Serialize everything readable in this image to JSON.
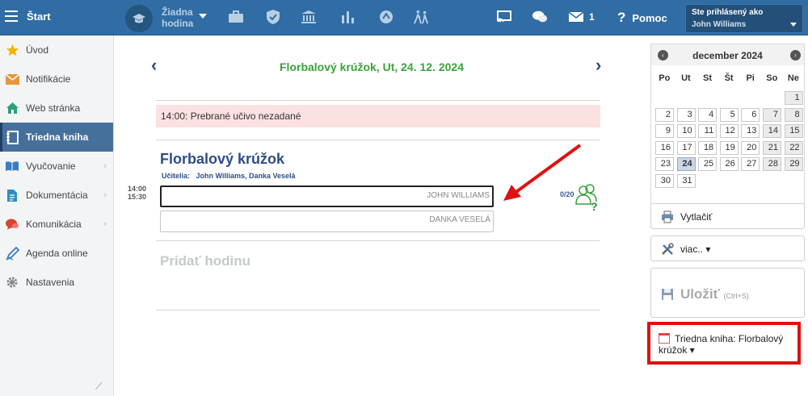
{
  "topbar": {
    "start_label": "Štart",
    "no_lesson_line1": "Žiadna",
    "no_lesson_line2": "hodina",
    "messages_count": "1",
    "help_label": "Pomoc",
    "help_icon": "?",
    "user_prefix": "Ste prihlásený ako",
    "user_name": "John Williams",
    "icons": [
      "graduation-cap-icon",
      "briefcase-icon",
      "shield-check-icon",
      "bank-icon",
      "bar-chart-icon",
      "badge-icon",
      "walking-people-icon",
      "cast-icon",
      "chat-bubbles-icon",
      "envelope-icon"
    ]
  },
  "sidebar": {
    "items": [
      {
        "label": "Úvod",
        "icon": "star-icon",
        "color": "#f1b400"
      },
      {
        "label": "Notifikácie",
        "icon": "envelope-icon",
        "color": "#e8963a"
      },
      {
        "label": "Web stránka",
        "icon": "home-icon",
        "color": "#2e9e7a"
      },
      {
        "label": "Triedna kniha",
        "icon": "notebook-icon",
        "color": "#ffffff",
        "active": true
      },
      {
        "label": "Vyučovanie",
        "icon": "open-book-icon",
        "color": "#3a7cc0",
        "has_submenu": true
      },
      {
        "label": "Dokumentácia",
        "icon": "document-icon",
        "color": "#2e8fc0",
        "has_submenu": true
      },
      {
        "label": "Komunikácia",
        "icon": "chat-icon",
        "color": "#d5452f",
        "has_submenu": true
      },
      {
        "label": "Agenda online",
        "icon": "pen-icon",
        "color": "#3a7cc0"
      },
      {
        "label": "Nastavenia",
        "icon": "gear-icon",
        "color": "#888888"
      }
    ]
  },
  "main": {
    "prev_arrow": "‹",
    "next_arrow": "›",
    "title": "Florbalový krúžok, Ut, 24. 12. 2024",
    "alert": "14:00: Prebrané učivo nezadané",
    "lesson": {
      "name": "Florbalový krúžok",
      "teachers_label": "Učitelia:",
      "teachers": "John Williams, Danka Veselá",
      "time_start": "14:00",
      "time_end": "15:30",
      "teacher_boxes": [
        "JOHN WILLIAMS",
        "DANKA VESELÁ"
      ],
      "attendance": "0/20"
    },
    "add_lesson": "Pridať hodinu"
  },
  "calendar": {
    "month": "december 2024",
    "prev": "‹",
    "next": "›",
    "dows": [
      "Po",
      "Ut",
      "St",
      "Št",
      "Pi",
      "So",
      "Ne"
    ],
    "weeks": [
      [
        "",
        "",
        "",
        "",
        "",
        "",
        "1"
      ],
      [
        "2",
        "3",
        "4",
        "5",
        "6",
        "7",
        "8"
      ],
      [
        "9",
        "10",
        "11",
        "12",
        "13",
        "14",
        "15"
      ],
      [
        "16",
        "17",
        "18",
        "19",
        "20",
        "21",
        "22"
      ],
      [
        "23",
        "24",
        "25",
        "26",
        "27",
        "28",
        "29"
      ],
      [
        "30",
        "31",
        "",
        "",
        "",
        "",
        ""
      ]
    ],
    "today": "24"
  },
  "actions": {
    "print_label": "Vytlačiť",
    "more_label": "viac.. ▾",
    "save_label": "Uložiť",
    "save_hint": "(Ctrl+S)",
    "classbook_label": "Triedna kniha: Florbalový krúžok ▾"
  },
  "colors": {
    "topbar": "#2f6da4",
    "title_green": "#3aa33a",
    "alert_bg": "#fbe1df",
    "highlight_red": "#e01010",
    "link_blue": "#2d4d86"
  }
}
